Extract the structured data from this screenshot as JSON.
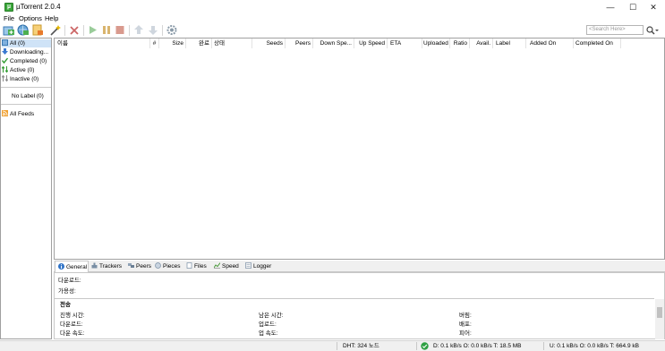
{
  "window": {
    "title": "µTorrent 2.0.4",
    "app_icon_glyph": "µ",
    "minimize_glyph": "—",
    "maximize_glyph": "☐",
    "close_glyph": "✕"
  },
  "menu": [
    "File",
    "Options",
    "Help"
  ],
  "toolbar": {
    "search_placeholder": "<Search Here>",
    "icons": [
      "add-torrent-icon",
      "add-url-icon",
      "create-torrent-icon",
      "wand-icon",
      "remove-icon",
      "start-icon",
      "pause-icon",
      "stop-icon",
      "move-up-icon",
      "move-down-icon",
      "preferences-icon"
    ]
  },
  "sidebar": {
    "items": [
      {
        "label": "All (0)",
        "icon": "all-icon"
      },
      {
        "label": "Downloading...",
        "icon": "downloading-icon"
      },
      {
        "label": "Completed (0)",
        "icon": "completed-icon"
      },
      {
        "label": "Active (0)",
        "icon": "active-icon"
      },
      {
        "label": "Inactive (0)",
        "icon": "inactive-icon"
      }
    ],
    "no_label": "No Label (0)",
    "feeds": "All Feeds"
  },
  "columns": [
    "이름",
    "#",
    "Size",
    "완료",
    "상태",
    "Seeds",
    "Peers",
    "Down Spe...",
    "Up Speed",
    "ETA",
    "Uploaded",
    "Ratio",
    "Avail.",
    "Label",
    "Added On",
    "Completed On"
  ],
  "tabs": [
    {
      "label": "General",
      "icon": "info-icon"
    },
    {
      "label": "Trackers",
      "icon": "trackers-icon"
    },
    {
      "label": "Peers",
      "icon": "peers-icon"
    },
    {
      "label": "Pieces",
      "icon": "pieces-icon"
    },
    {
      "label": "Files",
      "icon": "files-icon"
    },
    {
      "label": "Speed",
      "icon": "speed-icon"
    },
    {
      "label": "Logger",
      "icon": "logger-icon"
    }
  ],
  "general": {
    "downloaded": "다운로드:",
    "availability": "가용성:",
    "transfer_title": "전송",
    "row1": [
      "진행 시간:",
      "남은 시간:",
      "버림:"
    ],
    "row2": [
      "다운로드:",
      "업로드:",
      "배포:"
    ],
    "row3": [
      "다운 속도:",
      "업 속도:",
      "피어:"
    ]
  },
  "status": {
    "dht": "DHT: 324 노드",
    "down": "D: 0.1 kB/s O: 0.0 kB/s T: 18.5 MB",
    "up": "U: 0.1 kB/s O: 0.0 kB/s T: 664.9 kB"
  }
}
